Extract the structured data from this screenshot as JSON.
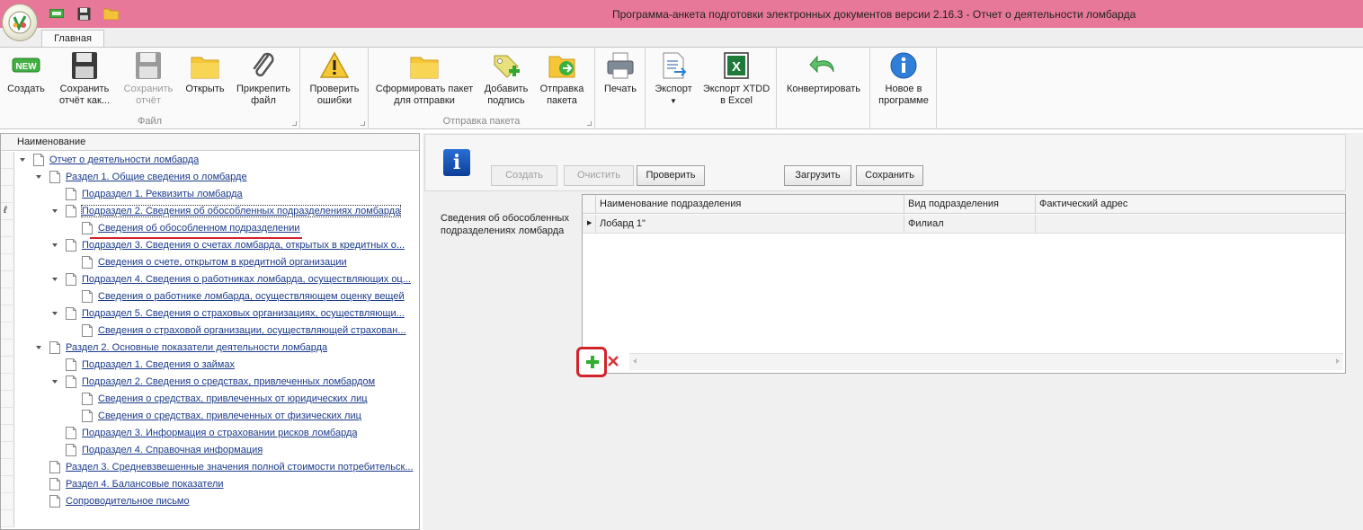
{
  "window": {
    "title": "Программа-анкета подготовки электронных документов версии 2.16.3  - Отчет о деятельности ломбарда"
  },
  "quick_access": [
    "new-icon",
    "save-icon",
    "open-folder-icon"
  ],
  "tabs": [
    {
      "label": "Главная",
      "active": true
    }
  ],
  "ribbon": {
    "groups": [
      {
        "label": "Файл",
        "buttons": [
          {
            "label1": "Создать",
            "label2": "",
            "icon": "new-badge-icon",
            "enabled": true
          },
          {
            "label1": "Сохранить",
            "label2": "отчёт как...",
            "icon": "floppy-icon",
            "enabled": true
          },
          {
            "label1": "Сохранить",
            "label2": "отчёт",
            "icon": "floppy-icon",
            "enabled": false
          },
          {
            "label1": "Открыть",
            "label2": "",
            "icon": "folder-icon",
            "enabled": true
          },
          {
            "label1": "Прикрепить",
            "label2": "файл",
            "icon": "paperclip-icon",
            "enabled": true
          }
        ]
      },
      {
        "label": "",
        "buttons": [
          {
            "label1": "Проверить",
            "label2": "ошибки",
            "icon": "warning-icon",
            "enabled": true
          }
        ]
      },
      {
        "label": "Отправка пакета",
        "buttons": [
          {
            "label1": "Сформировать пакет",
            "label2": "для отправки",
            "icon": "folder-icon",
            "enabled": true
          },
          {
            "label1": "Добавить",
            "label2": "подпись",
            "icon": "tag-add-icon",
            "enabled": true
          },
          {
            "label1": "Отправка",
            "label2": "пакета",
            "icon": "send-icon",
            "enabled": true
          }
        ]
      },
      {
        "label": "",
        "buttons": [
          {
            "label1": "Печать",
            "label2": "",
            "icon": "printer-icon",
            "enabled": true
          }
        ]
      },
      {
        "label": "",
        "buttons": [
          {
            "label1": "Экспорт",
            "label2": "",
            "icon": "export-icon",
            "enabled": true
          },
          {
            "label1": "Экспорт XTDD",
            "label2": "в Excel",
            "icon": "excel-icon",
            "enabled": true
          }
        ]
      },
      {
        "label": "",
        "buttons": [
          {
            "label1": "Конвертировать",
            "label2": "",
            "icon": "convert-arrow-icon",
            "enabled": true
          }
        ]
      },
      {
        "label": "",
        "buttons": [
          {
            "label1": "Новое в",
            "label2": "программе",
            "icon": "info-icon",
            "enabled": true
          }
        ]
      }
    ]
  },
  "tree": {
    "header": "Наименование",
    "items": [
      {
        "label": "Отчет о деятельности ломбарда",
        "level": 0,
        "expanded": true
      },
      {
        "label": "Раздел 1. Общие сведения о ломбарде",
        "level": 1,
        "expanded": true
      },
      {
        "label": "Подраздел 1. Реквизиты ломбарда",
        "level": 2,
        "expanded": null
      },
      {
        "label": "Подраздел 2. Сведения об обособленных подразделениях ломбарда",
        "level": 2,
        "expanded": true,
        "focused": true
      },
      {
        "label": "Сведения об обособленном подразделении",
        "level": 3,
        "expanded": null
      },
      {
        "label": "Подраздел 3. Сведения о счетах ломбарда, открытых в кредитных о...",
        "level": 2,
        "expanded": true
      },
      {
        "label": "Сведения о счете, открытом в кредитной организации",
        "level": 3,
        "expanded": null
      },
      {
        "label": "Подраздел 4. Сведения о работниках ломбарда, осуществляющих оц...",
        "level": 2,
        "expanded": true
      },
      {
        "label": "Сведения о работнике ломбарда, осуществляющем оценку вещей",
        "level": 3,
        "expanded": null
      },
      {
        "label": "Подраздел 5. Сведения о страховых организациях, осуществляющи...",
        "level": 2,
        "expanded": true
      },
      {
        "label": "Сведения о страховой организации, осуществляющей страхован...",
        "level": 3,
        "expanded": null
      },
      {
        "label": "Раздел 2. Основные показатели деятельности ломбарда",
        "level": 1,
        "expanded": true
      },
      {
        "label": "Подраздел 1. Сведения о займах",
        "level": 2,
        "expanded": null
      },
      {
        "label": "Подраздел 2. Сведения о средствах, привлеченных ломбардом",
        "level": 2,
        "expanded": true
      },
      {
        "label": "Сведения о средствах, привлеченных от юридических лиц",
        "level": 3,
        "expanded": null
      },
      {
        "label": "Сведения о средствах, привлеченных от физических лиц",
        "level": 3,
        "expanded": null
      },
      {
        "label": "Подраздел 3. Информация о страховании рисков ломбарда",
        "level": 2,
        "expanded": null
      },
      {
        "label": "Подраздел 4. Справочная информация",
        "level": 2,
        "expanded": null
      },
      {
        "label": "Раздел 3. Средневзвешенные значения полной стоимости потребительск...",
        "level": 1,
        "expanded": null
      },
      {
        "label": "Раздел 4. Балансовые показатели",
        "level": 1,
        "expanded": null
      },
      {
        "label": "Сопроводительное письмо",
        "level": 1,
        "expanded": null
      }
    ]
  },
  "toolbar": {
    "create": "Создать",
    "clear": "Очистить",
    "check": "Проверить",
    "load": "Загрузить",
    "save": "Сохранить"
  },
  "section": {
    "title": "Сведения об обособленных подразделениях ломбарда"
  },
  "grid": {
    "columns": [
      "Наименование подразделения",
      "Вид подразделения",
      "Фактический адрес"
    ],
    "rows": [
      [
        "Лобард 1\"",
        "Филиал",
        ""
      ]
    ]
  }
}
